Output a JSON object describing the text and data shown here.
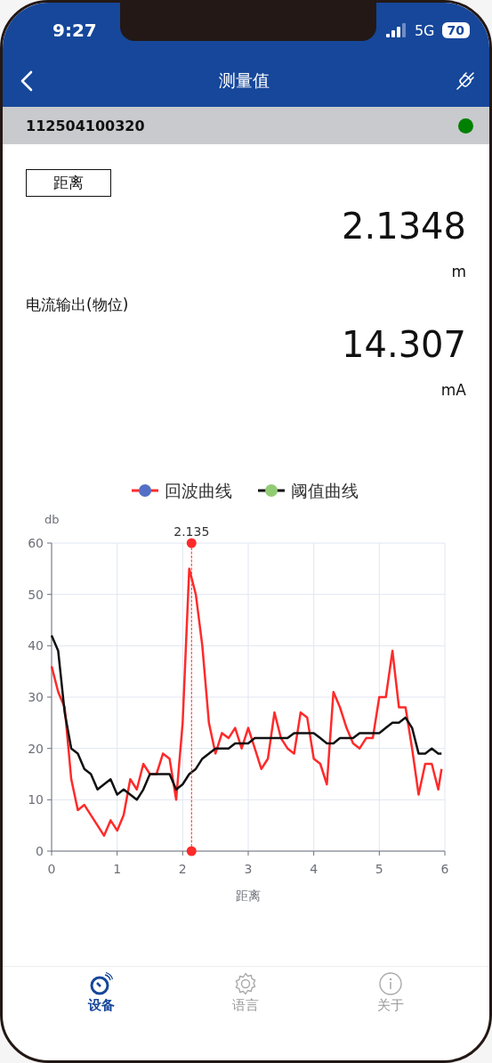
{
  "status_bar": {
    "time": "9:27",
    "network": "5G",
    "battery": "70"
  },
  "header": {
    "title": "测量值"
  },
  "device": {
    "serial": "112504100320",
    "color": "#008000"
  },
  "readings": [
    {
      "kind": "boxed",
      "label": "距离",
      "value": "2.1348",
      "unit": "m"
    },
    {
      "kind": "plain",
      "label": "电流输出(物位)",
      "value": "14.307",
      "unit": "mA"
    }
  ],
  "chart": {
    "chart_data": {
      "type": "line",
      "xlabel": "距离",
      "ylabel": "db",
      "xlim": [
        0,
        6
      ],
      "ylim": [
        0,
        60
      ],
      "xticks": [
        0,
        1,
        2,
        3,
        4,
        5,
        6
      ],
      "yticks": [
        0,
        10,
        20,
        30,
        40,
        50,
        60
      ],
      "x": [
        0,
        0.1,
        0.2,
        0.3,
        0.4,
        0.5,
        0.6,
        0.7,
        0.8,
        0.9,
        1.0,
        1.1,
        1.2,
        1.3,
        1.4,
        1.5,
        1.6,
        1.7,
        1.8,
        1.9,
        2.0,
        2.1,
        2.2,
        2.3,
        2.4,
        2.5,
        2.6,
        2.7,
        2.8,
        2.9,
        3.0,
        3.1,
        3.2,
        3.3,
        3.4,
        3.5,
        3.6,
        3.7,
        3.8,
        3.9,
        4.0,
        4.1,
        4.2,
        4.3,
        4.4,
        4.5,
        4.6,
        4.7,
        4.8,
        4.9,
        5.0,
        5.1,
        5.2,
        5.3,
        5.4,
        5.5,
        5.6,
        5.7,
        5.8,
        5.9,
        5.95
      ],
      "series": [
        {
          "name": "回波曲线",
          "color": "#ff2a2a",
          "values": [
            36,
            31,
            28,
            14,
            8,
            9,
            7,
            5,
            3,
            6,
            4,
            7,
            14,
            12,
            17,
            15,
            15,
            19,
            18,
            10,
            25,
            55,
            50,
            40,
            25,
            19,
            23,
            22,
            24,
            20,
            24,
            20,
            16,
            18,
            27,
            22,
            20,
            19,
            27,
            26,
            18,
            17,
            13,
            31,
            28,
            24,
            21,
            20,
            22,
            22,
            30,
            30,
            39,
            28,
            28,
            20,
            11,
            17,
            17,
            12,
            16
          ]
        },
        {
          "name": "阈值曲线",
          "color": "#111111",
          "values": [
            42,
            39,
            27,
            20,
            19,
            16,
            15,
            12,
            13,
            14,
            11,
            12,
            11,
            10,
            12,
            15,
            15,
            15,
            15,
            12,
            13,
            15,
            16,
            18,
            19,
            20,
            20,
            20,
            21,
            21,
            21,
            22,
            22,
            22,
            22,
            22,
            22,
            23,
            23,
            23,
            23,
            22,
            21,
            21,
            22,
            22,
            22,
            23,
            23,
            23,
            23,
            24,
            25,
            25,
            26,
            24,
            19,
            19,
            20,
            19,
            19
          ]
        }
      ],
      "grid": true,
      "legend": true,
      "ref_lines": [
        {
          "axis": "x",
          "value": 2.135,
          "label": "2.135",
          "color": "#ff2a2a"
        }
      ]
    }
  },
  "tabs": [
    {
      "label": "设备",
      "selected": true
    },
    {
      "label": "语言",
      "selected": false
    },
    {
      "label": "关于",
      "selected": false
    }
  ]
}
